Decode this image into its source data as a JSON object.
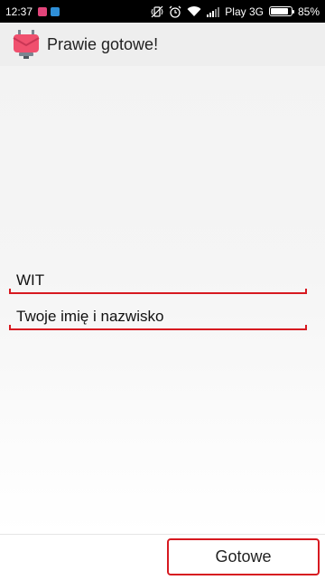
{
  "status_bar": {
    "time": "12:37",
    "carrier": "Play 3G",
    "battery_percent": "85%",
    "battery_level": 0.85,
    "icons": [
      "notification-app-icon",
      "notification-calendar-icon",
      "vibrate-icon",
      "alarm-icon",
      "wifi-icon",
      "signal-icon",
      "battery-icon"
    ]
  },
  "app_bar": {
    "title": "Prawie gotowe!",
    "icon": "app-logo-icon"
  },
  "form": {
    "field1_value": "WIT",
    "field2_placeholder": "Twoje imię i nazwisko"
  },
  "actions": {
    "done_label": "Gotowe"
  },
  "colors": {
    "accent": "#d71920",
    "appbar_bg": "#eeeeee",
    "status_bar_bg": "#000000"
  }
}
